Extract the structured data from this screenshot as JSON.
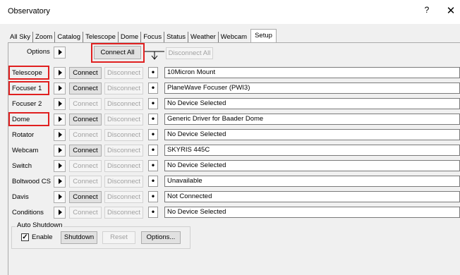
{
  "window": {
    "title": "Observatory",
    "help_label": "?",
    "close_label": "✕"
  },
  "tabs": [
    "All Sky",
    "Zoom",
    "Catalog",
    "Telescope",
    "Dome",
    "Focus",
    "Status",
    "Weather",
    "Webcam",
    "Setup"
  ],
  "active_tab": "Setup",
  "options_row": {
    "label": "Options",
    "connect_all": "Connect All",
    "disconnect_all": "Disconnect All"
  },
  "devices": [
    {
      "label": "Telescope",
      "connect": "Connect",
      "connect_enabled": true,
      "disconnect": "Disconnect",
      "value": "10Micron Mount",
      "highlighted": true
    },
    {
      "label": "Focuser 1",
      "connect": "Connect",
      "connect_enabled": true,
      "disconnect": "Disconnect",
      "value": "PlaneWave Focuser (PWI3)",
      "highlighted": true
    },
    {
      "label": "Focuser 2",
      "connect": "Connect",
      "connect_enabled": false,
      "disconnect": "Disconnect",
      "value": "No Device Selected",
      "highlighted": false
    },
    {
      "label": "Dome",
      "connect": "Connect",
      "connect_enabled": true,
      "disconnect": "Disconnect",
      "value": "Generic Driver for Baader Dome",
      "highlighted": true
    },
    {
      "label": "Rotator",
      "connect": "Connect",
      "connect_enabled": false,
      "disconnect": "Disconnect",
      "value": "No Device Selected",
      "highlighted": false
    },
    {
      "label": "Webcam",
      "connect": "Connect",
      "connect_enabled": true,
      "disconnect": "Disconnect",
      "value": "SKYRIS 445C",
      "highlighted": false
    },
    {
      "label": "Switch",
      "connect": "Connect",
      "connect_enabled": false,
      "disconnect": "Disconnect",
      "value": "No Device Selected",
      "highlighted": false
    },
    {
      "label": "Boltwood CS",
      "connect": "Connect",
      "connect_enabled": false,
      "disconnect": "Disconnect",
      "value": "Unavailable",
      "highlighted": false
    },
    {
      "label": "Davis",
      "connect": "Connect",
      "connect_enabled": true,
      "disconnect": "Disconnect",
      "value": "Not Connected",
      "highlighted": false
    },
    {
      "label": "Conditions",
      "connect": "Connect",
      "connect_enabled": false,
      "disconnect": "Disconnect",
      "value": "No Device Selected",
      "highlighted": false
    }
  ],
  "dot_glyph": "•",
  "auto_shutdown": {
    "title": "Auto Shutdown",
    "enable_label": "Enable",
    "enabled": true,
    "check_glyph": "✓",
    "shutdown": "Shutdown",
    "reset": "Reset",
    "options": "Options..."
  },
  "colors": {
    "highlight": "#e02020",
    "disabled_text": "#a0a0a0"
  }
}
